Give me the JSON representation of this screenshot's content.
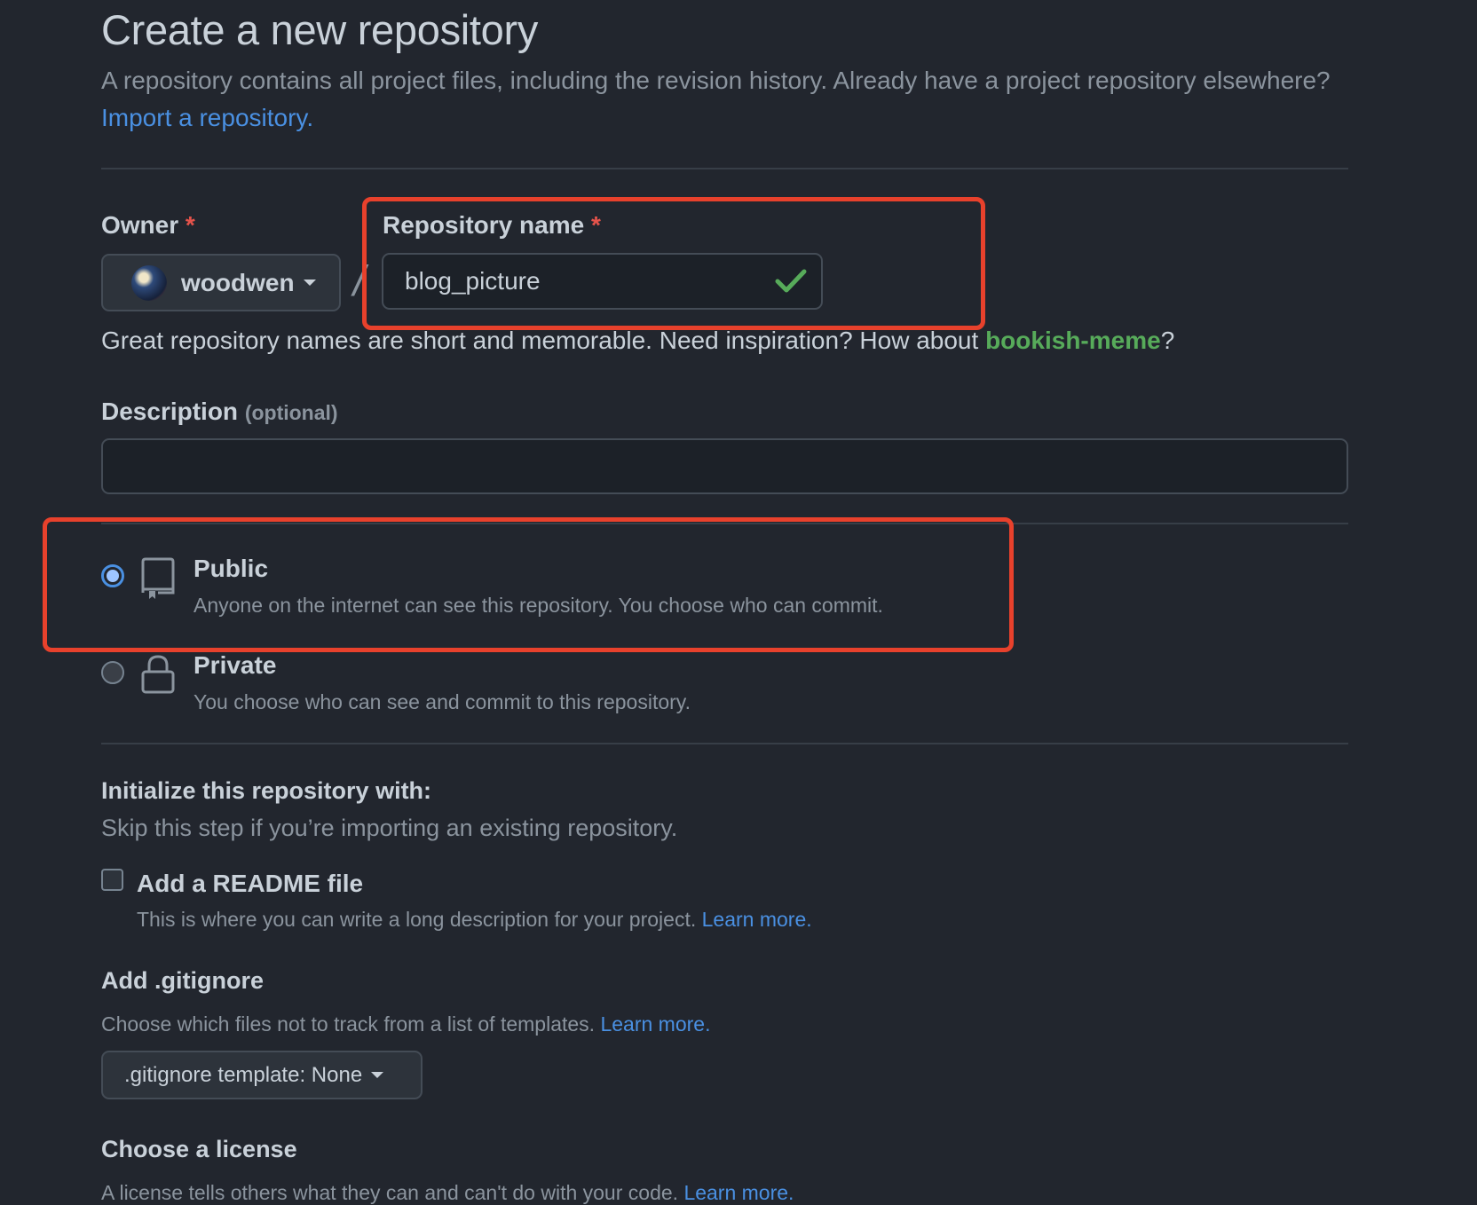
{
  "page": {
    "title": "Create a new repository",
    "lead_text": "A repository contains all project files, including the revision history. Already have a project repository elsewhere?",
    "import_link": "Import a repository."
  },
  "owner": {
    "label": "Owner",
    "required_mark": "*",
    "value": "woodwen"
  },
  "separator": "/",
  "repository_name": {
    "label": "Repository name",
    "required_mark": "*",
    "value": "blog_picture",
    "valid": true
  },
  "name_hint": {
    "text": "Great repository names are short and memorable. Need inspiration? How about",
    "suggestion": "bookish-meme",
    "suffix": "?"
  },
  "description": {
    "label": "Description",
    "optional": "(optional)",
    "value": ""
  },
  "visibility": {
    "selected": "public",
    "options": [
      {
        "id": "public",
        "title": "Public",
        "desc": "Anyone on the internet can see this repository. You choose who can commit.",
        "icon": "repo-icon"
      },
      {
        "id": "private",
        "title": "Private",
        "desc": "You choose who can see and commit to this repository.",
        "icon": "lock-icon"
      }
    ]
  },
  "initialize": {
    "title": "Initialize this repository with:",
    "subtitle": "Skip this step if you’re importing an existing repository.",
    "readme": {
      "label": "Add a README file",
      "checked": false,
      "desc": "This is where you can write a long description for your project.",
      "learn_more": "Learn more."
    }
  },
  "gitignore": {
    "title": "Add .gitignore",
    "desc": "Choose which files not to track from a list of templates.",
    "learn_more": "Learn more.",
    "button_label": ".gitignore template: None"
  },
  "license": {
    "title": "Choose a license",
    "desc": "A license tells others what they can and can't do with your code.",
    "learn_more": "Learn more."
  },
  "colors": {
    "background": "#22262e",
    "link": "#4a90e2",
    "success": "#57ab5a",
    "required": "#e5534b",
    "highlight": "#e8412c"
  }
}
